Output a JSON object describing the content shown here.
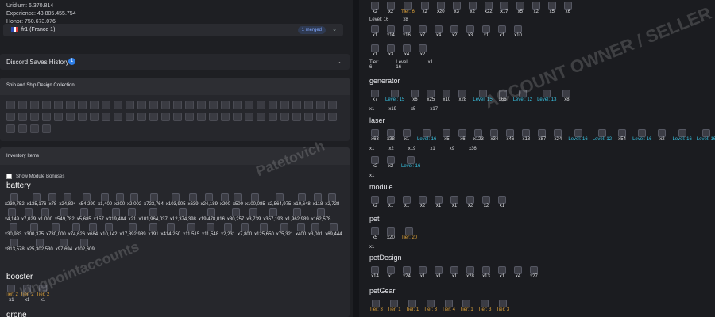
{
  "stats": {
    "uridium": "Uridium: 6.370.814",
    "experience": "Experience: 43.805.455.754",
    "honor": "Honor: 750.673.076"
  },
  "server": {
    "name": "fr1 (France 1)",
    "badge": "1 merged"
  },
  "discord": {
    "title": "Discord Saves History",
    "info": "1"
  },
  "ships": {
    "title": "Ship and Ship Design Collection",
    "count": 60
  },
  "inventory": {
    "title": "Inventory Items",
    "module_bonuses_label": "Show Module Bonuses",
    "battery": {
      "title": "battery",
      "qtys": [
        "x230,752",
        "x135,176",
        "x78",
        "x24,894",
        "x54,290",
        "x1,400",
        "x200",
        "x2,002",
        "x723,764",
        "x103,905",
        "x639",
        "x24,189",
        "x200",
        "x500",
        "x100,085",
        "x2,564,975",
        "x10,648",
        "x118",
        "x2,728",
        "x4,149",
        "x7,029",
        "x1,000",
        "x549,782",
        "x5,685",
        "x157",
        "x319,484",
        "x21",
        "x101,964,037",
        "x12,374,398",
        "x19,478,016",
        "x80,257",
        "x3,739",
        "x357,193",
        "x1,962,989",
        "x162,578",
        "x30,983",
        "x300,375",
        "x730,000",
        "x74,626",
        "x684",
        "x10,142",
        "x17,892,989",
        "x191",
        "x414,250",
        "x11,515",
        "x11,548",
        "x2,231",
        "x7,800",
        "x125,650",
        "x75,321",
        "x400",
        "x3,001",
        "x69,444",
        "x813,578",
        "x25,302,530",
        "x97,694",
        "x102,609"
      ]
    },
    "booster": {
      "title": "booster",
      "tiers": [
        "Tier: 2",
        "Tier: 2",
        "Tier: 2"
      ],
      "qtys": [
        "x1",
        "x1",
        "x1"
      ]
    },
    "drone": {
      "title": "drone"
    }
  },
  "right": {
    "top_row1": [
      "x2",
      "x2",
      "Tier: 6",
      "x2",
      "x20",
      "x3",
      "x2",
      "x22",
      "x17",
      "x5",
      "x2",
      "x5",
      "x6"
    ],
    "top_level": "Level: 16",
    "top_x8": "x8",
    "top_row2": [
      "x1",
      "x14",
      "x16",
      "x7",
      "x4",
      "x2",
      "x3",
      "x1",
      "x1",
      "x10"
    ],
    "top_row3": [
      "x1",
      "x3",
      "x4",
      "x2"
    ],
    "top_tier6": "Tier: 6",
    "top_level2": "Level: 16",
    "top_x1": "x1",
    "generator": {
      "title": "generator",
      "row": [
        "x7",
        "Level: 15",
        "x6",
        "x25",
        "x10",
        "x28",
        "Level: 15",
        "x66",
        "Level: 12",
        "Level: 13",
        "x8"
      ],
      "sub": [
        "x1",
        "x19",
        "x5",
        "x17"
      ]
    },
    "laser": {
      "title": "laser",
      "row": [
        "x63",
        "x38",
        "x1",
        "Level: 16",
        "x5",
        "x6",
        "x123",
        "x34",
        "x46",
        "x13",
        "x87",
        "x24",
        "Level: 16",
        "Level: 12",
        "x54",
        "Level: 16",
        "x2",
        "Level: 16",
        "Level: 16"
      ],
      "sub": [
        "x1",
        "x2",
        "x19",
        "x1",
        "x9",
        "x36"
      ],
      "row2": [
        "x2",
        "x2",
        "Level: 16"
      ],
      "row2sub": "x1"
    },
    "module": {
      "title": "module",
      "qtys": [
        "x2",
        "x1",
        "x1",
        "x2",
        "x1",
        "x1",
        "x2",
        "x2",
        "x1"
      ]
    },
    "pet": {
      "title": "pet",
      "qtys": [
        "x5",
        "x20",
        "Tier: 20"
      ],
      "sub": "x1"
    },
    "petDesign": {
      "title": "petDesign",
      "qtys": [
        "x14",
        "x1",
        "x24",
        "x1",
        "x1",
        "x1",
        "x28",
        "x13",
        "x1",
        "x4",
        "x27"
      ]
    },
    "petGear": {
      "title": "petGear",
      "tiers": [
        "Tier: 3",
        "Tier: 1",
        "Tier: 1",
        "Tier: 3",
        "Tier: 4",
        "Tier: 1",
        "Tier: 3",
        "Tier: 3"
      ]
    }
  },
  "watermarks": {
    "w1": "ACCOUNT OWNER / SELLER",
    "w2": "Patetovich",
    "w3": "kingpointaccounts"
  }
}
